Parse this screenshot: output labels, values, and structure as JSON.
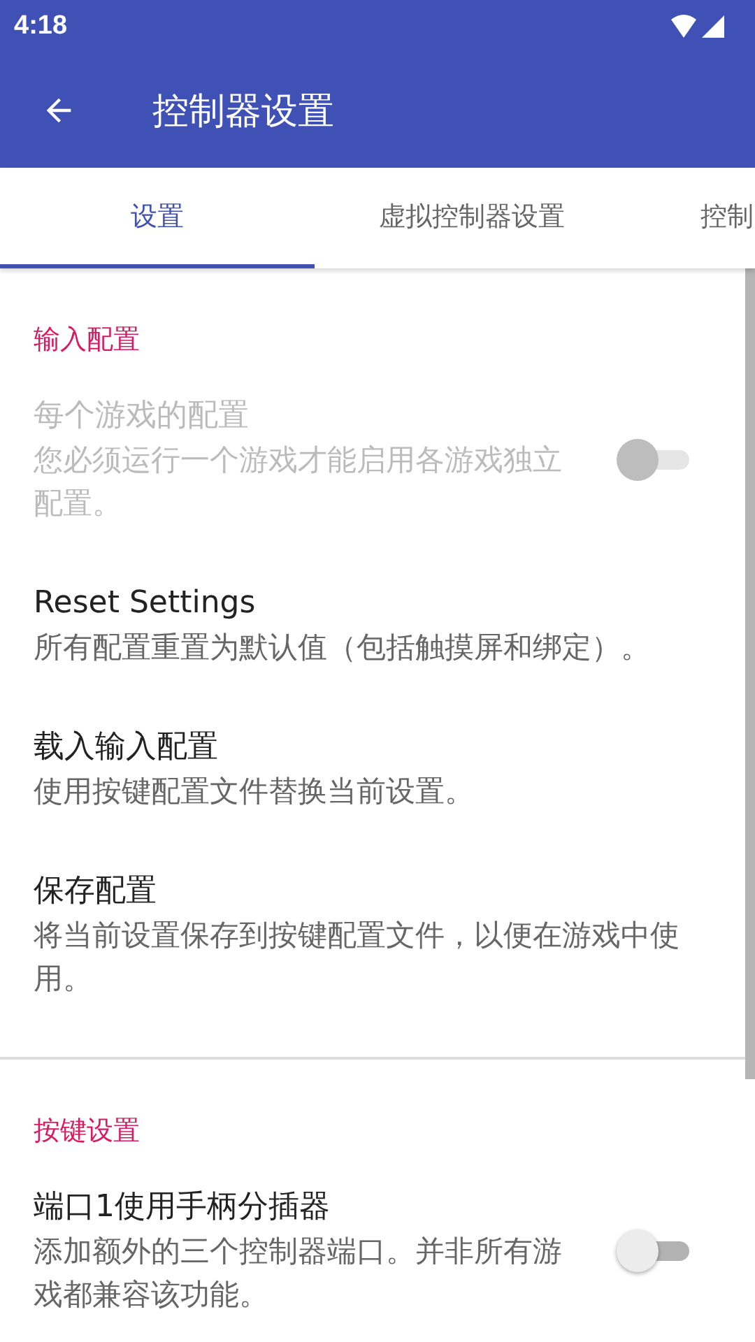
{
  "status_bar": {
    "time": "4:18"
  },
  "toolbar": {
    "title": "控制器设置"
  },
  "tabs": [
    {
      "label": "设置",
      "selected": true
    },
    {
      "label": "虚拟控制器设置",
      "selected": false
    },
    {
      "label": "控制",
      "selected": false
    }
  ],
  "sections": [
    {
      "header": "输入配置",
      "items": [
        {
          "kind": "switch",
          "title": "每个游戏的配置",
          "summary": "您必须运行一个游戏才能启用各游戏独立配置。",
          "disabled": true,
          "on": false
        },
        {
          "kind": "plain",
          "title": "Reset Settings",
          "summary": "所有配置重置为默认值（包括触摸屏和绑定）。",
          "disabled": false
        },
        {
          "kind": "plain",
          "title": "载入输入配置",
          "summary": "使用按键配置文件替换当前设置。",
          "disabled": false
        },
        {
          "kind": "plain",
          "title": "保存配置",
          "summary": "将当前设置保存到按键配置文件，以便在游戏中使用。",
          "disabled": false
        }
      ]
    },
    {
      "header": "按键设置",
      "items": [
        {
          "kind": "switch",
          "title": "端口1使用手柄分插器",
          "summary": "添加额外的三个控制器端口。并非所有游戏都兼容该功能。",
          "disabled": false,
          "on": false
        }
      ]
    }
  ]
}
